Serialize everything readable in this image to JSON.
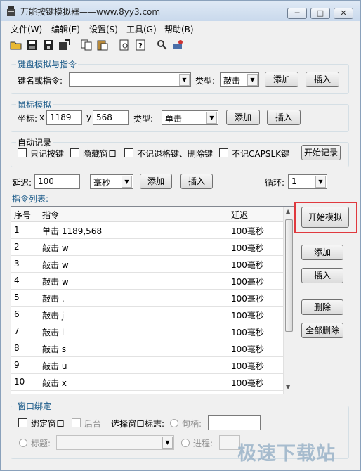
{
  "window": {
    "title": "万能按键模拟器——www.8yy3.com",
    "minimize_glyph": "─",
    "maximize_glyph": "□",
    "close_glyph": "✕"
  },
  "menu": [
    "文件(W)",
    "编辑(E)",
    "设置(S)",
    "工具(G)",
    "帮助(B)"
  ],
  "toolbar": [
    "open-folder-icon",
    "save-icon",
    "save-as-icon",
    "export-icon",
    "copy-icon",
    "paste-icon",
    "preview-icon",
    "help-icon",
    "search-icon",
    "run-icon"
  ],
  "keyboard": {
    "group_label": "键盘模拟与指令",
    "key_label": "键名或指令:",
    "key_value": "",
    "type_label": "类型:",
    "type_value": "敲击",
    "add": "添加",
    "insert": "插入"
  },
  "mouse": {
    "group_label": "鼠标模拟",
    "coord_label": "坐标:",
    "x_label": "x",
    "x_value": "1189",
    "y_label": "y",
    "y_value": "568",
    "type_label": "类型:",
    "type_value": "单击",
    "add": "添加",
    "insert": "插入"
  },
  "autorecord": {
    "group_label": "自动记录",
    "opt1": "只记按键",
    "opt2": "隐藏窗口",
    "opt3": "不记退格键、删除键",
    "opt4": "不记CAPSLK键",
    "start": "开始记录"
  },
  "delay": {
    "label": "延迟:",
    "value": "100",
    "unit": "毫秒",
    "add": "添加",
    "insert": "插入",
    "loop_label": "循环:",
    "loop_value": "1"
  },
  "list": {
    "label": "指令列表:",
    "headers": [
      "序号",
      "指令",
      "延迟"
    ],
    "rows": [
      [
        "1",
        "单击 1189,568",
        "100毫秒"
      ],
      [
        "2",
        "敲击 w",
        "100毫秒"
      ],
      [
        "3",
        "敲击 w",
        "100毫秒"
      ],
      [
        "4",
        "敲击 w",
        "100毫秒"
      ],
      [
        "5",
        "敲击 .",
        "100毫秒"
      ],
      [
        "6",
        "敲击 j",
        "100毫秒"
      ],
      [
        "7",
        "敲击 i",
        "100毫秒"
      ],
      [
        "8",
        "敲击 s",
        "100毫秒"
      ],
      [
        "9",
        "敲击 u",
        "100毫秒"
      ],
      [
        "10",
        "敲击 x",
        "100毫秒"
      ]
    ]
  },
  "side": {
    "start_sim": "开始模拟",
    "add": "添加",
    "insert": "插入",
    "delete": "删除",
    "delete_all": "全部删除"
  },
  "binding": {
    "group_label": "窗口绑定",
    "bind": "绑定窗口",
    "background": "后台",
    "select_label": "选择窗口标志:",
    "handle": "句柄:",
    "title": "标题:",
    "process": "进程:"
  },
  "watermark": "极速下载站"
}
